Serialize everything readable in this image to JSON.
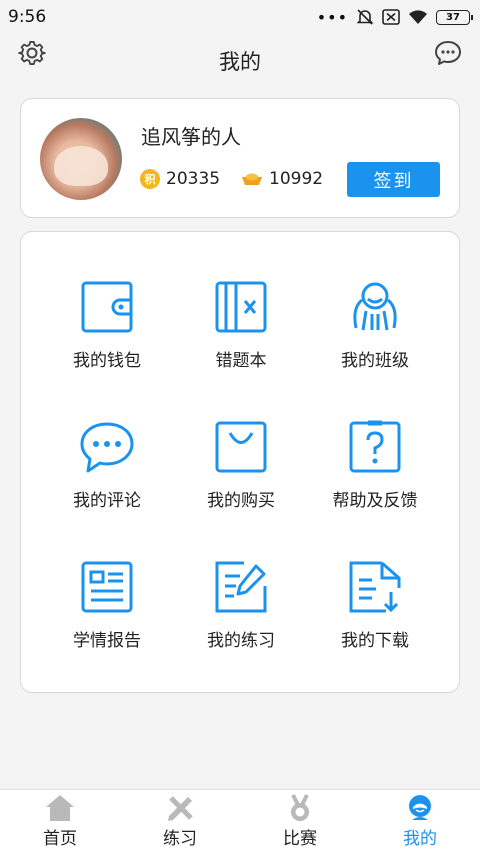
{
  "status_bar": {
    "time": "9:56",
    "battery": "37"
  },
  "header": {
    "title": "我的"
  },
  "profile": {
    "username": "追风筝的人",
    "points_badge": "积",
    "points": "20335",
    "gold": "10992",
    "signin_label": "签到"
  },
  "menu": {
    "items": [
      {
        "label": "我的钱包",
        "icon": "wallet-icon"
      },
      {
        "label": "错题本",
        "icon": "mistake-book-icon"
      },
      {
        "label": "我的班级",
        "icon": "class-icon"
      },
      {
        "label": "我的评论",
        "icon": "comment-icon"
      },
      {
        "label": "我的购买",
        "icon": "shopping-bag-icon"
      },
      {
        "label": "帮助及反馈",
        "icon": "help-icon"
      },
      {
        "label": "学情报告",
        "icon": "report-icon"
      },
      {
        "label": "我的练习",
        "icon": "practice-icon"
      },
      {
        "label": "我的下载",
        "icon": "download-icon"
      }
    ]
  },
  "tabs": [
    {
      "label": "首页",
      "icon": "home-icon"
    },
    {
      "label": "练习",
      "icon": "practice-tab-icon"
    },
    {
      "label": "比赛",
      "icon": "medal-icon"
    },
    {
      "label": "我的",
      "icon": "profile-icon",
      "active": true
    }
  ],
  "colors": {
    "accent": "#1a93ef",
    "coin": "#f5b51c",
    "gold": "#f0a020"
  }
}
